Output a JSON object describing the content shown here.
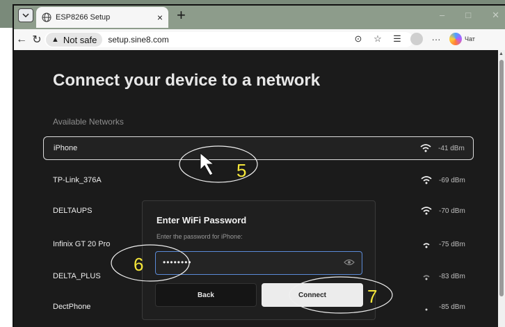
{
  "browser": {
    "tab_title": "ESP8266 Setup",
    "tab_close": "×",
    "new_tab": "+",
    "win_min": "–",
    "win_max": "□",
    "win_close": "✕",
    "security_label": "Not safe",
    "url": "setup.sine8.com",
    "more": "···",
    "chat_label": "Чат"
  },
  "page": {
    "heading": "Connect your device to a network",
    "subheading": "Available Networks",
    "networks": [
      {
        "name": "iPhone",
        "signal": "-41 dBm",
        "selected": true
      },
      {
        "name": "TP-Link_376A",
        "signal": "-69 dBm"
      },
      {
        "name": "DELTAUPS",
        "signal": "-70 dBm"
      },
      {
        "name": "Infinix GT 20 Pro",
        "signal": "-75 dBm"
      },
      {
        "name": "DELTA_PLUS",
        "signal": "-83 dBm"
      },
      {
        "name": "DectPhone",
        "signal": "-85 dBm"
      }
    ]
  },
  "modal": {
    "title": "Enter WiFi Password",
    "prompt": "Enter the password for iPhone:",
    "password_mask": "••••••••",
    "back_label": "Back",
    "connect_label": "Connect"
  },
  "annotations": {
    "step5": "5",
    "step6": "6",
    "step7": "7",
    "color": "#f5e63a"
  },
  "icons": [
    "chevron-down-icon",
    "globe-icon",
    "back-arrow-icon",
    "reload-icon",
    "warning-icon",
    "reading-mode-icon",
    "star-icon",
    "favorites-icon",
    "profile-icon",
    "wifi-icon",
    "eye-icon",
    "cursor-icon"
  ]
}
